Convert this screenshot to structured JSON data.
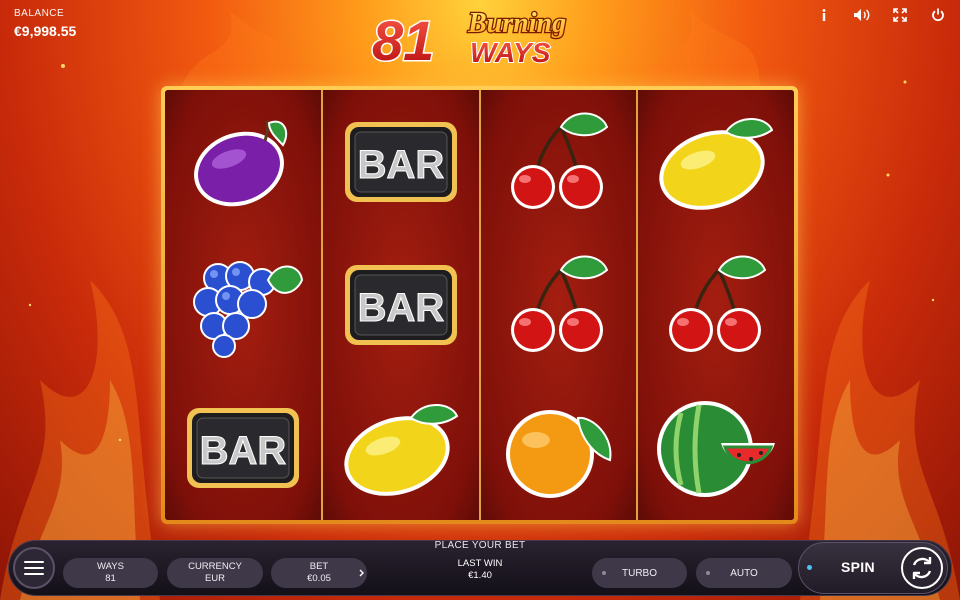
{
  "balance": {
    "label": "BALANCE",
    "value": "€9,998.55"
  },
  "logo": {
    "number": "81",
    "line1": "Burning",
    "line2": "WAYS"
  },
  "top_icons": [
    "info-icon",
    "sound-icon",
    "fullscreen-icon",
    "power-icon"
  ],
  "reels": [
    [
      "plum",
      "grapes",
      "bar"
    ],
    [
      "bar",
      "bar",
      "lemon"
    ],
    [
      "cherry",
      "cherry",
      "orange"
    ],
    [
      "lemon",
      "cherry",
      "watermelon"
    ]
  ],
  "bar_text": "BAR",
  "bottom": {
    "place_bet": "PLACE YOUR BET",
    "ways": {
      "label": "WAYS",
      "value": "81"
    },
    "currency": {
      "label": "CURRENCY",
      "value": "EUR"
    },
    "bet": {
      "label": "BET",
      "value": "€0.05"
    },
    "last_win": {
      "label": "LAST WIN",
      "value": "€1.40"
    },
    "turbo": "TURBO",
    "auto": "AUTO",
    "spin": "SPIN"
  },
  "colors": {
    "accent": "#4fc3f7",
    "frame": "#e8a33a",
    "reel_bg": "#8a140b"
  }
}
